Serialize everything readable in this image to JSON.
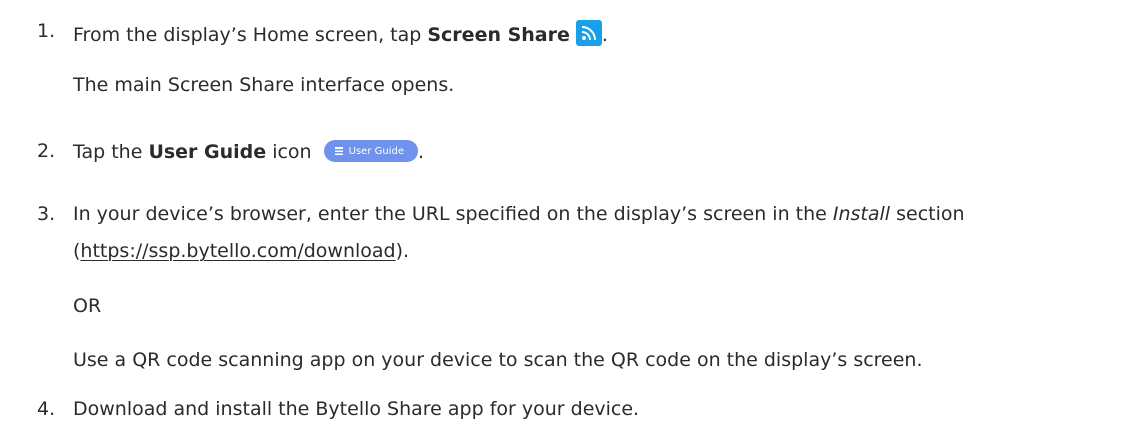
{
  "steps": [
    {
      "number": "1.",
      "before": "From the display’s Home screen, tap ",
      "bold": "Screen Share",
      "icon": "screen-share-icon",
      "after": ".",
      "result": "The main Screen Share interface opens."
    },
    {
      "number": "2.",
      "before": "Tap the ",
      "bold": "User Guide",
      "middle": " icon ",
      "icon": "user-guide-icon",
      "icon_label": "User Guide",
      "after": "."
    },
    {
      "number": "3.",
      "line1_before": "In your device’s browser, enter the URL specified on the display’s screen in the ",
      "italic": "Install",
      "line1_after": " section",
      "line2_open": "(",
      "url": "https://ssp.bytello.com/download",
      "line2_close": ").",
      "or": "OR",
      "alternative": "Use a QR code scanning app on your device to scan the QR code on the display’s screen."
    },
    {
      "number": "4.",
      "text": "Download and install the Bytello Share app for your device."
    }
  ],
  "colors": {
    "text": "#2b2b2b",
    "share_icon_bg": "#1aa0e8",
    "guide_pill_bg": "#6f92ec"
  }
}
